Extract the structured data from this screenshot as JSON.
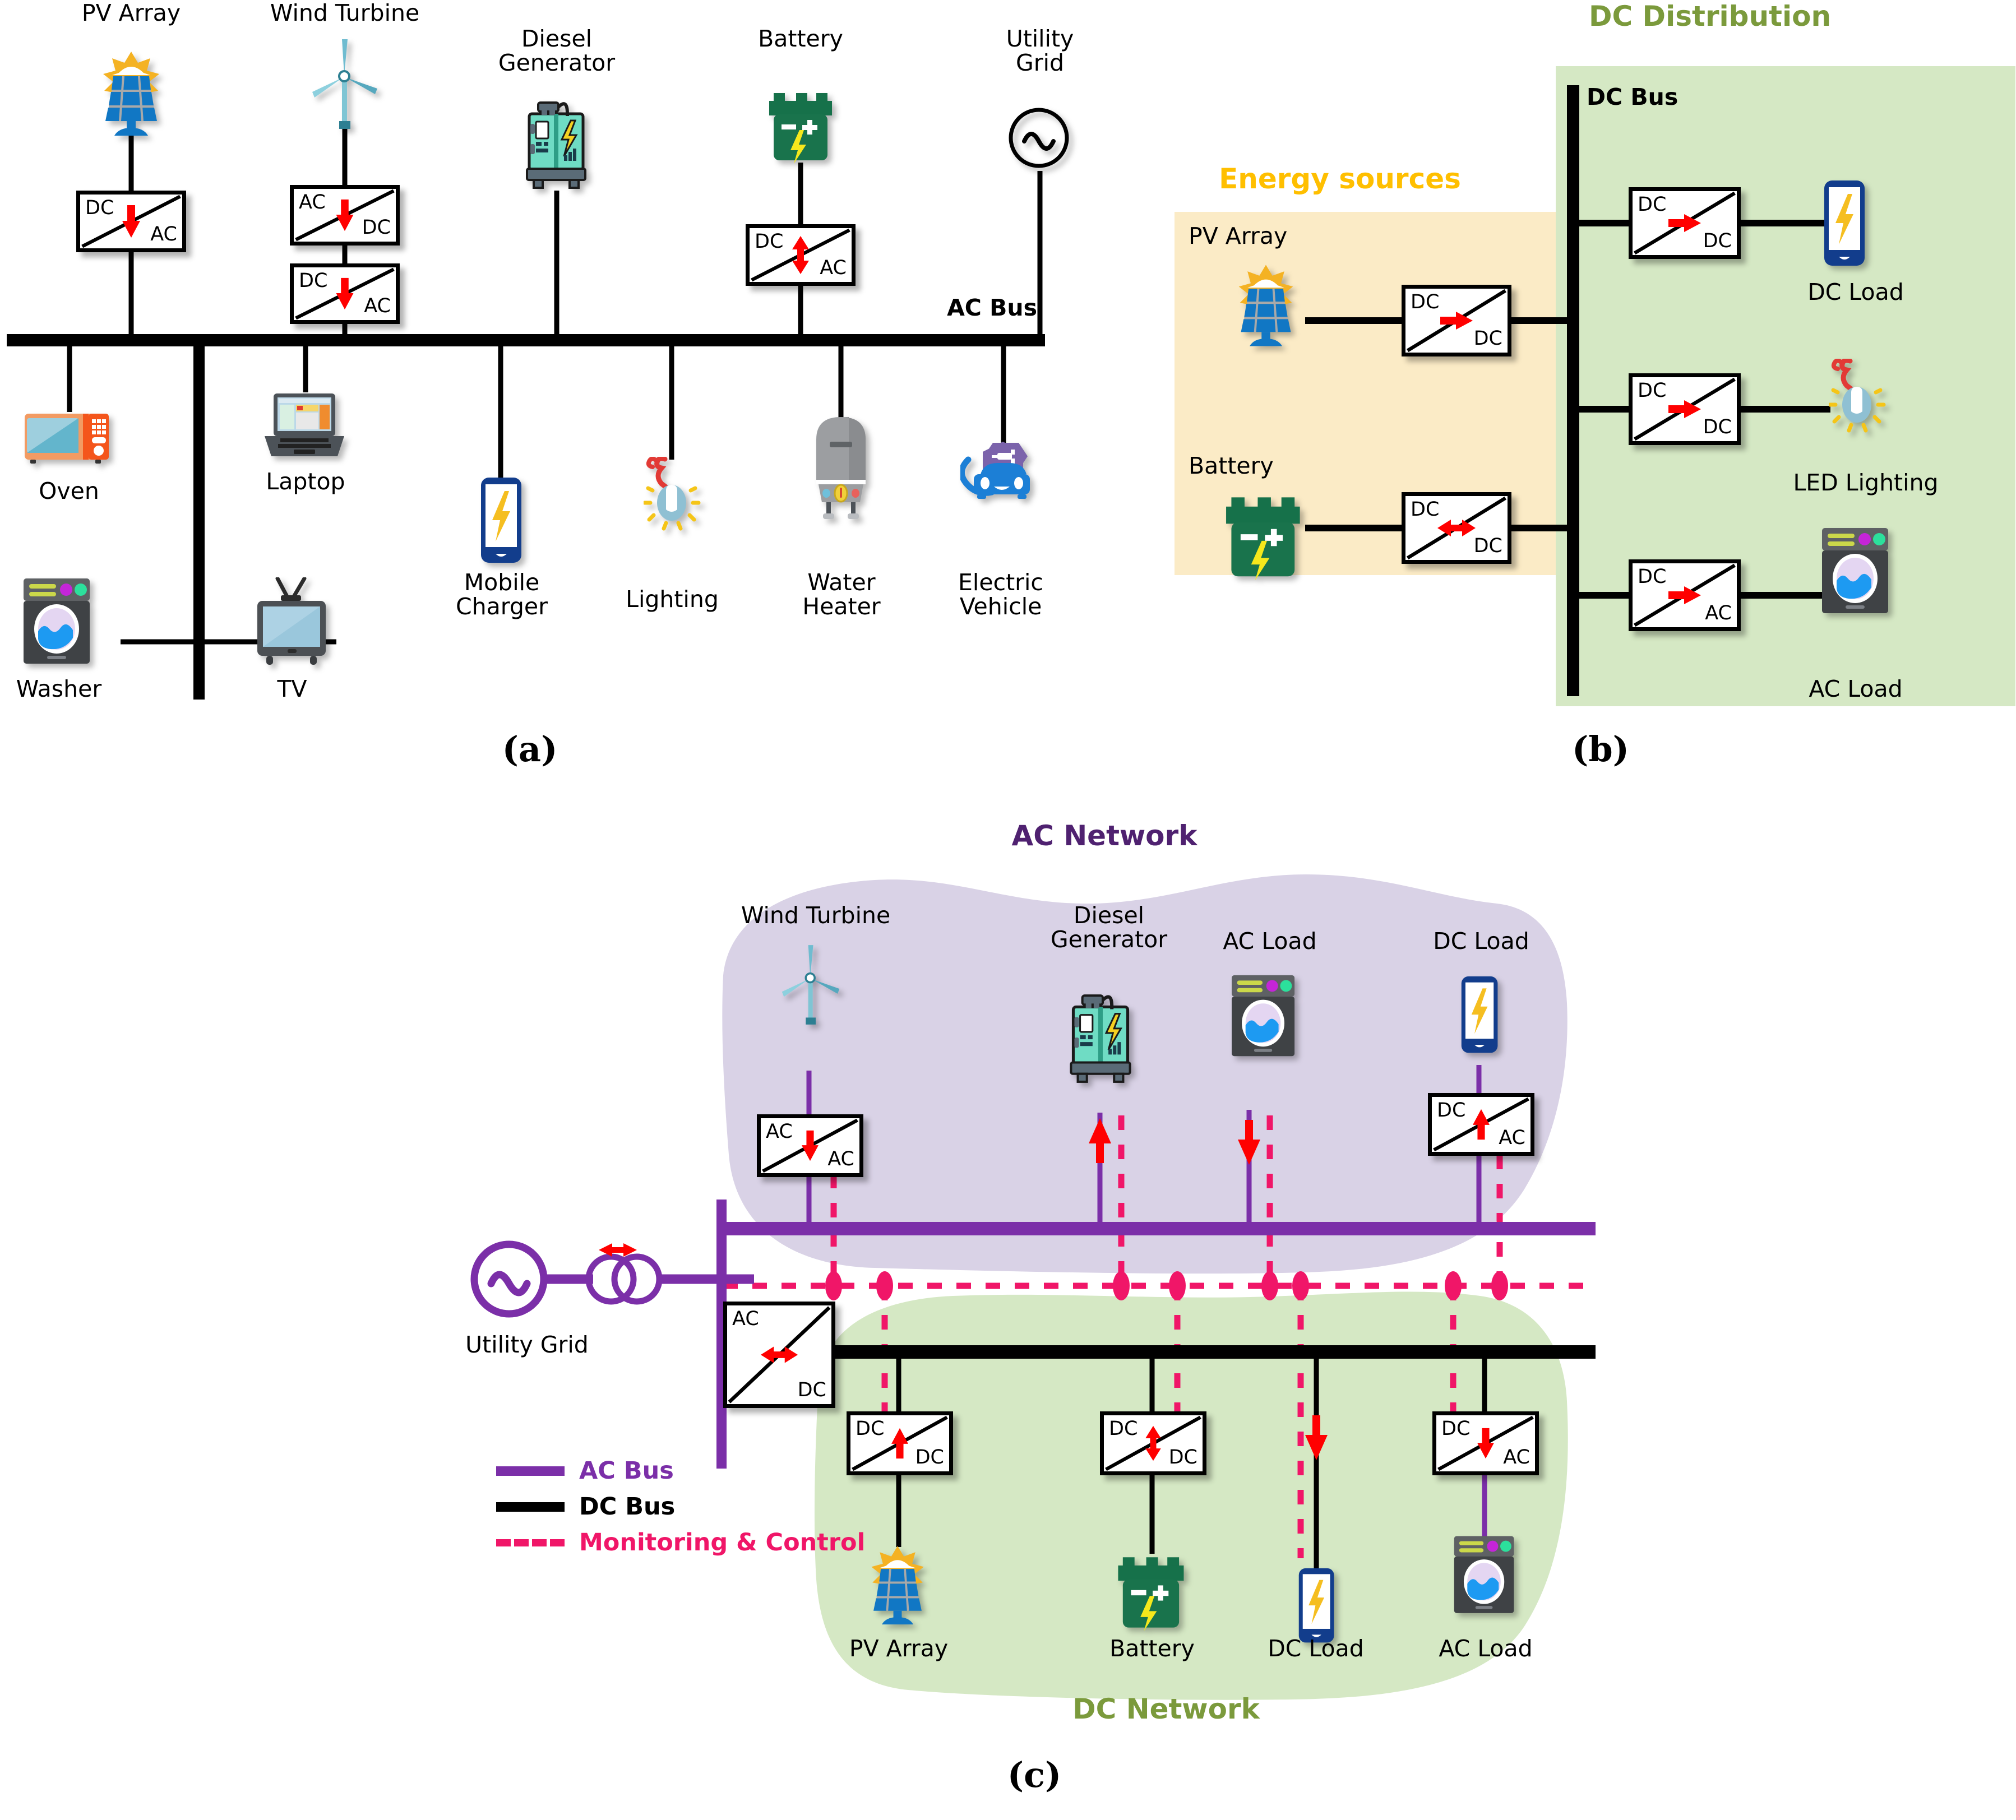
{
  "colors": {
    "ac_bus_purple": "#7B2FA8",
    "dc_bus_black": "#000000",
    "monitoring_pink": "#F01668",
    "ac_network_fill": "#D9D2E6",
    "dc_network_fill": "#D5E8C4",
    "energy_sources_fill": "#FBEBC6",
    "dc_distribution_fill": "#D5E8C4",
    "arrow_red": "#FF0000",
    "ac_network_title": "#4F2170",
    "dc_network_title": "#7B9A3C",
    "dc_distribution_title": "#7B9A3C",
    "energy_sources_title": "#FFBF00"
  },
  "panel_a": {
    "letter": "(a)",
    "bus_label": "AC Bus",
    "sources": [
      {
        "name": "PV Array",
        "label": "PV Array",
        "icon": "pv-array-icon",
        "converters": [
          {
            "in": "DC",
            "out": "AC",
            "arrow": "down"
          }
        ]
      },
      {
        "name": "Wind Turbine",
        "label": "Wind Turbine",
        "icon": "wind-turbine-icon",
        "converters": [
          {
            "in": "AC",
            "out": "DC",
            "arrow": "down"
          },
          {
            "in": "DC",
            "out": "AC",
            "arrow": "down"
          }
        ]
      },
      {
        "name": "Diesel Generator",
        "label": "Diesel\nGenerator",
        "icon": "diesel-generator-icon",
        "converters": []
      },
      {
        "name": "Battery",
        "label": "Battery",
        "icon": "battery-icon",
        "converters": [
          {
            "in": "DC",
            "out": "AC",
            "arrow": "both"
          }
        ]
      },
      {
        "name": "Utility Grid",
        "label": "Utility\nGrid",
        "icon": "utility-grid-icon",
        "converters": []
      }
    ],
    "loads": [
      {
        "label": "Oven",
        "icon": "oven-icon"
      },
      {
        "label": "Laptop",
        "icon": "laptop-icon"
      },
      {
        "label": "Mobile\nCharger",
        "icon": "mobile-charger-icon"
      },
      {
        "label": "Lighting",
        "icon": "lighting-icon"
      },
      {
        "label": "Water\nHeater",
        "icon": "water-heater-icon"
      },
      {
        "label": "Electric\nVehicle",
        "icon": "electric-vehicle-icon"
      },
      {
        "label": "Washer",
        "icon": "washer-icon"
      },
      {
        "label": "TV",
        "icon": "tv-icon"
      }
    ]
  },
  "panel_b": {
    "letter": "(b)",
    "energy_sources_title": "Energy sources",
    "dc_distribution_title": "DC Distribution",
    "bus_label": "DC Bus",
    "sources": [
      {
        "label": "PV Array",
        "icon": "pv-array-icon",
        "converter": {
          "in": "DC",
          "out": "DC",
          "arrow": "right"
        }
      },
      {
        "label": "Battery",
        "icon": "battery-icon",
        "converter": {
          "in": "DC",
          "out": "DC",
          "arrow": "both-h"
        }
      }
    ],
    "loads": [
      {
        "label": "DC Load",
        "icon": "mobile-charger-icon",
        "converter": {
          "in": "DC",
          "out": "DC",
          "arrow": "right"
        }
      },
      {
        "label": "LED Lighting",
        "icon": "lighting-icon",
        "converter": {
          "in": "DC",
          "out": "DC",
          "arrow": "right"
        }
      },
      {
        "label": "AC Load",
        "icon": "washer-icon",
        "converter": {
          "in": "DC",
          "out": "AC",
          "arrow": "right"
        }
      }
    ]
  },
  "panel_c": {
    "letter": "(c)",
    "ac_network_title": "AC Network",
    "dc_network_title": "DC Network",
    "utility_grid_label": "Utility Grid",
    "legend": [
      {
        "label": "AC Bus",
        "style": "solid",
        "color": "#7B2FA8"
      },
      {
        "label": "DC Bus",
        "style": "solid",
        "color": "#000000"
      },
      {
        "label": "Monitoring & Control",
        "style": "dashed",
        "color": "#F01668"
      }
    ],
    "ac_items": [
      {
        "label": "Wind Turbine",
        "icon": "wind-turbine-icon",
        "converter": {
          "in": "AC",
          "out": "AC",
          "arrow": "down"
        }
      },
      {
        "label": "Diesel\nGenerator",
        "icon": "diesel-generator-icon",
        "converter": null,
        "flow_arrow": "down"
      },
      {
        "label": "AC Load",
        "icon": "washer-icon",
        "converter": null,
        "flow_arrow": "up"
      },
      {
        "label": "DC Load",
        "icon": "mobile-charger-icon",
        "converter": {
          "in": "DC",
          "out": "AC",
          "arrow": "up"
        }
      }
    ],
    "dc_items": [
      {
        "label": "PV Array",
        "icon": "pv-array-icon",
        "converter": {
          "in": "DC",
          "out": "DC",
          "arrow": "up"
        }
      },
      {
        "label": "Battery",
        "icon": "battery-icon",
        "converter": {
          "in": "DC",
          "out": "DC",
          "arrow": "both"
        }
      },
      {
        "label": "DC Load",
        "icon": "mobile-charger-icon",
        "converter": null,
        "flow_arrow": "down"
      },
      {
        "label": "AC Load",
        "icon": "washer-icon",
        "converter": {
          "in": "DC",
          "out": "AC",
          "arrow": "down"
        }
      }
    ],
    "grid_tie_converter": {
      "in": "AC",
      "out": "DC",
      "arrow": "both-h"
    },
    "grid_tie_arrow": "both-h"
  }
}
